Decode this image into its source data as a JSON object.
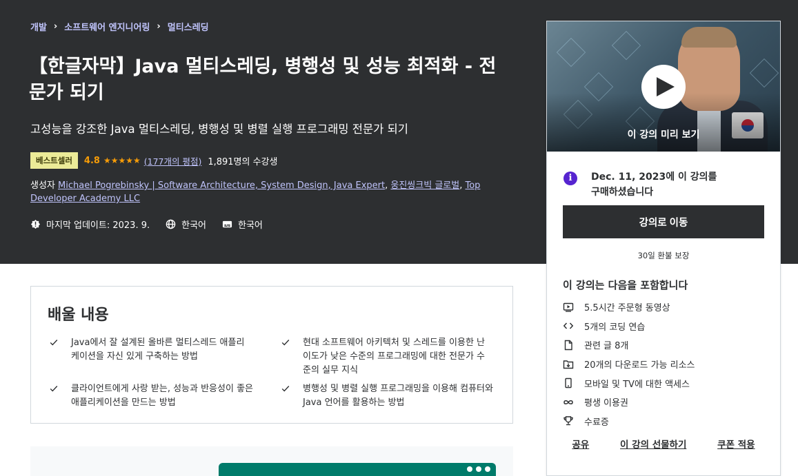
{
  "breadcrumb": [
    "개발",
    "소프트웨어 엔지니어링",
    "멀티스레딩"
  ],
  "course": {
    "title": "【한글자막】Java 멀티스레딩, 병행성 및 성능 최적화 - 전문가 되기",
    "subtitle": "고성능을 강조한 Java 멀티스레딩, 병행성 및 병렬 실행 프로그래밍 전문가 되기",
    "badge": "베스트셀러",
    "rating": "4.8",
    "stars": "★★★★★",
    "rating_count": "(177개의 평점)",
    "students": "1,891명의 수강생",
    "creator_label": "생성자",
    "creators": [
      "Michael Pogrebinsky | Software Architecture, System Design, Java Expert",
      "웅진씽크빅 글로벌",
      "Top Developer Academy LLC"
    ],
    "last_updated": "마지막 업데이트: 2023. 9.",
    "language": "한국어",
    "captions": "한국어"
  },
  "sidebar": {
    "preview_label": "이 강의 미리 보기",
    "purchased_text": "Dec. 11, 2023에 이 강의를 구매하셨습니다",
    "go_button": "강의로 이동",
    "guarantee": "30일 환불 보장",
    "includes_title": "이 강의는 다음을 포함합니다",
    "includes": [
      {
        "icon": "video-icon",
        "label": "5.5시간 주문형 동영상"
      },
      {
        "icon": "code-icon",
        "label": "5개의 코딩 연습"
      },
      {
        "icon": "file-icon",
        "label": "관련 글 8개"
      },
      {
        "icon": "folder-download-icon",
        "label": "20개의 다운로드 가능 리소스"
      },
      {
        "icon": "mobile-icon",
        "label": "모바일 및 TV에 대한 액세스"
      },
      {
        "icon": "infinity-icon",
        "label": "평생 이용권"
      },
      {
        "icon": "trophy-icon",
        "label": "수료증"
      }
    ],
    "actions": [
      "공유",
      "이 강의 선물하기",
      "쿠폰 적용"
    ]
  },
  "learn": {
    "title": "배울 내용",
    "items": [
      "Java에서 잘 설계된 올바른 멀티스레드 애플리케이션을 자신 있게 구축하는 방법",
      "현대 소프트웨어 아키텍처 및 스레드를 이용한 난이도가 낮은 수준의 프로그래밍에 대한 전문가 수준의 실무 지식",
      "클라이언트에게 사랑 받는, 성능과 반응성이 좋은 애플리케이션을 만드는 방법",
      "병행성 및 병렬 실행 프로그래밍을 이용해 컴퓨터와 Java 언어를 활용하는 방법"
    ]
  },
  "colors": {
    "hero_bg": "#2d2f31",
    "link": "#c0c4fc",
    "star": "#f69c08",
    "badge": "#eceb98",
    "accent": "#5624d0",
    "teal": "#007b6a"
  }
}
